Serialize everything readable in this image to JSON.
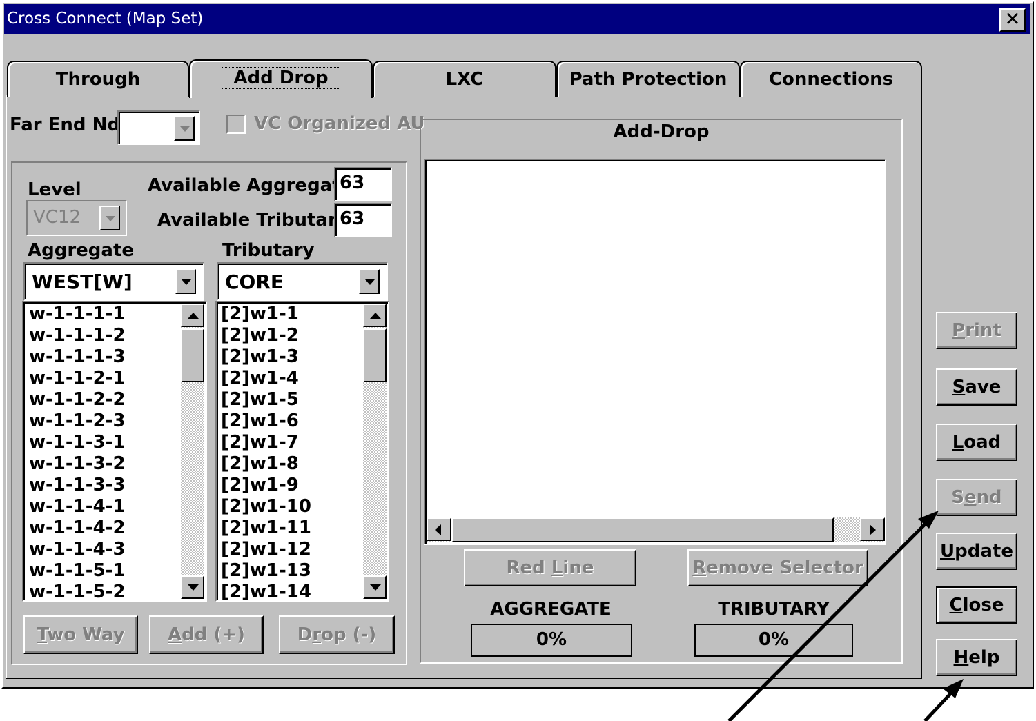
{
  "window": {
    "title": "Cross Connect (Map Set)",
    "close_glyph": "✕"
  },
  "tabs": [
    {
      "label": "Through"
    },
    {
      "label": "Add Drop"
    },
    {
      "label": "LXC"
    },
    {
      "label": "Path Protection"
    },
    {
      "label": "Connections"
    }
  ],
  "far_end": {
    "label": "Far End Nd",
    "value": ""
  },
  "vc_organized": {
    "label": "VC Organized AU",
    "checked": false
  },
  "level": {
    "label": "Level",
    "value": "VC12"
  },
  "available_aggregate": {
    "label": "Available Aggregate",
    "value": "63"
  },
  "available_tributary": {
    "label": "Available Tributary",
    "value": "63"
  },
  "aggregate": {
    "label": "Aggregate",
    "selected": "WEST[W]",
    "items": [
      "w-1-1-1-1",
      "w-1-1-1-2",
      "w-1-1-1-3",
      "w-1-1-2-1",
      "w-1-1-2-2",
      "w-1-1-2-3",
      "w-1-1-3-1",
      "w-1-1-3-2",
      "w-1-1-3-3",
      "w-1-1-4-1",
      "w-1-1-4-2",
      "w-1-1-4-3",
      "w-1-1-5-1",
      "w-1-1-5-2"
    ]
  },
  "tributary": {
    "label": "Tributary",
    "selected": "CORE",
    "items": [
      "[2]w1-1",
      "[2]w1-2",
      "[2]w1-3",
      "[2]w1-4",
      "[2]w1-5",
      "[2]w1-6",
      "[2]w1-7",
      "[2]w1-8",
      "[2]w1-9",
      "[2]w1-10",
      "[2]w1-11",
      "[2]w1-12",
      "[2]w1-13",
      "[2]w1-14"
    ]
  },
  "actions": {
    "two_way": {
      "pre": "",
      "u": "T",
      "post": "wo Way"
    },
    "add": {
      "pre": "",
      "u": "A",
      "post": "dd (+)"
    },
    "drop": {
      "pre": "D",
      "u": "r",
      "post": "op (-)"
    }
  },
  "add_drop": {
    "title": "Add-Drop",
    "red_line": {
      "pre": "Red ",
      "u": "L",
      "post": "ine"
    },
    "remove_selector": {
      "pre": "",
      "u": "R",
      "post": "emove Selector"
    },
    "aggregate_label": "AGGREGATE",
    "aggregate_value": "0%",
    "tributary_label": "TRIBUTARY",
    "tributary_value": "0%"
  },
  "side_buttons": {
    "print": {
      "pre": "",
      "u": "P",
      "post": "rint"
    },
    "save": {
      "pre": "",
      "u": "S",
      "post": "ave"
    },
    "load": {
      "pre": "",
      "u": "L",
      "post": "oad"
    },
    "send": {
      "pre": "S",
      "u": "e",
      "post": "nd"
    },
    "update": {
      "pre": "",
      "u": "U",
      "post": "pdate"
    },
    "close": {
      "pre": "",
      "u": "C",
      "post": "lose"
    },
    "help": {
      "pre": "",
      "u": "H",
      "post": "elp"
    }
  }
}
